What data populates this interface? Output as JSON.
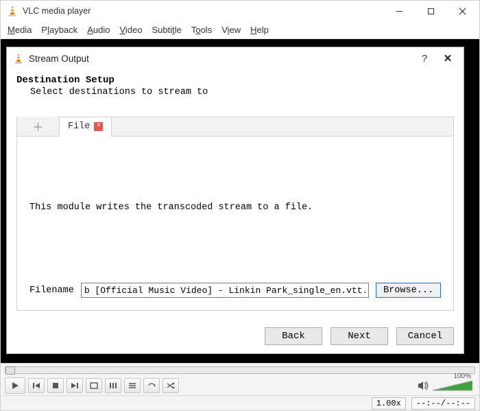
{
  "app": {
    "title": "VLC media player",
    "menus": [
      "Media",
      "Playback",
      "Audio",
      "Video",
      "Subtitle",
      "Tools",
      "View",
      "Help"
    ]
  },
  "dialog": {
    "title": "Stream Output",
    "section_title": "Destination Setup",
    "section_sub": "Select destinations to stream to",
    "tab_add_glyph": "＋",
    "tab_file_label": "File",
    "tab_close_glyph": "×",
    "module_text": "This module writes the transcoded stream to a file.",
    "filename_label": "Filename",
    "filename_value": "b [Official Music Video] - Linkin Park_single_en.vtt.ps",
    "browse_label": "Browse...",
    "buttons": {
      "back": "Back",
      "next": "Next",
      "cancel": "Cancel"
    },
    "help_glyph": "?",
    "close_glyph": "✕"
  },
  "status": {
    "speed": "1.00x",
    "time": "--:--/--:--",
    "volume_pct": "100%"
  },
  "icons": {
    "cone": "vlc-cone"
  }
}
